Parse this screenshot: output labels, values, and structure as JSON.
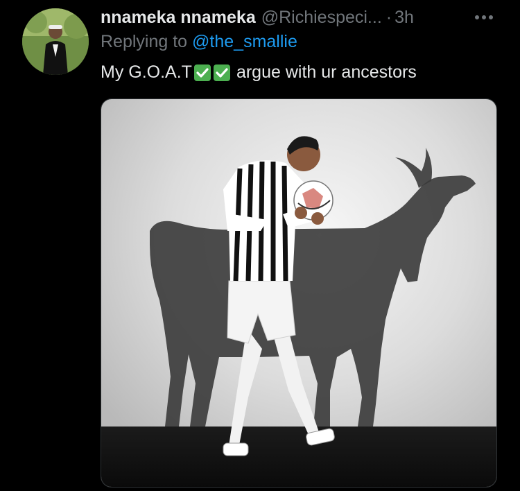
{
  "tweet": {
    "author": {
      "display_name": "nnameka nnameka",
      "handle": "@Richiespeci...",
      "avatar_icon": "profile-photo"
    },
    "separator": "·",
    "time": "3h",
    "reply_prefix": "Replying to",
    "reply_to": "@the_smallie",
    "text_before": "My G.O.A.T",
    "emoji": [
      "white-check-mark",
      "white-check-mark"
    ],
    "text_after": "argue with ur ancestors",
    "media": {
      "alt_icon": "player-and-goat-shadow-photo"
    }
  },
  "colors": {
    "background": "#000000",
    "primary_text": "#e7e9ea",
    "secondary_text": "#71767b",
    "link": "#1d9bf0",
    "check_green": "#4caf50"
  }
}
